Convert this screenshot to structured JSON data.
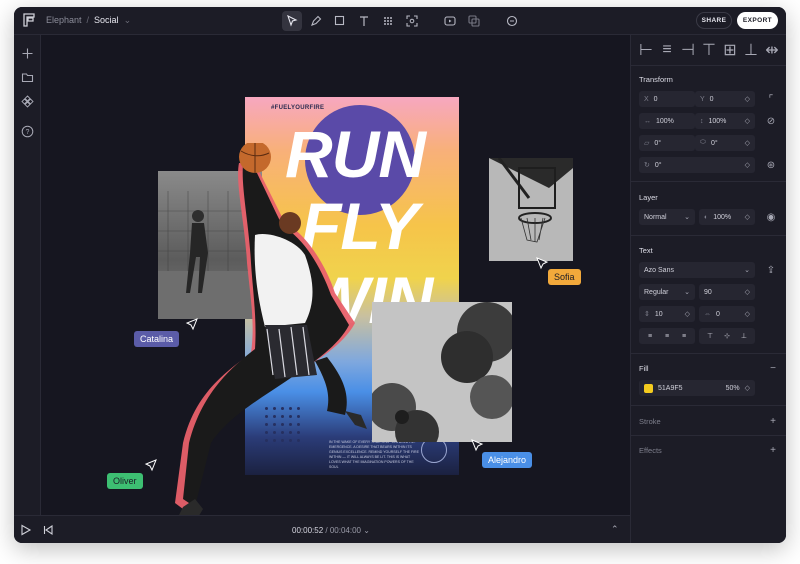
{
  "breadcrumb": {
    "project": "Elephant",
    "separator": "/",
    "page": "Social"
  },
  "toolbar": {
    "tools": [
      "select-tool",
      "pen-tool",
      "shape-tool",
      "text-tool",
      "grid-tool",
      "frame-tool",
      "media-tool",
      "boolean-tool",
      "comment-tool"
    ]
  },
  "actions": {
    "share": "SHARE",
    "export": "EXPORT"
  },
  "panel": {
    "transform": {
      "title": "Transform",
      "x_label": "X",
      "x": "0",
      "y_label": "Y",
      "y": "0",
      "width": "100%",
      "height": "100%",
      "skew_x": "0°",
      "skew_y": "0°",
      "rotation": "0°"
    },
    "layer": {
      "title": "Layer",
      "blend": "Normal",
      "opacity": "100%"
    },
    "text": {
      "title": "Text",
      "font": "Azo Sans",
      "weight": "Regular",
      "size": "90",
      "line_height": "10",
      "letter_spacing": "0"
    },
    "fill": {
      "title": "Fill",
      "hex": "51A9F5",
      "opacity": "50%",
      "swatch": "#f5cc1f"
    },
    "stroke": {
      "title": "Stroke"
    },
    "effects": {
      "title": "Effects"
    }
  },
  "poster": {
    "hashtag": "#FUELYOURFIRE",
    "line1": "RUN",
    "line2": "FLY",
    "line3": "WIN",
    "footer": "IN THE WAKE OF EVERY TRUE STEP IS A BOLD RE-EMERGENCE. A DESIRE THAT BEARS WITHIN ITS GENIUS EXCELLENCE. REMIND YOURSELF THE FIRE WITHIN — IT WILL ALWAYS BE LIT. THIS IS WHAT LOVES WHAT THE IMAGINATION POWERS OF THE SOUL"
  },
  "collaborators": [
    {
      "name": "Catalina",
      "color": "#5b5ca8"
    },
    {
      "name": "Sofia",
      "color": "#f2a93b"
    },
    {
      "name": "Alejandro",
      "color": "#4a8fe6"
    },
    {
      "name": "Oliver",
      "color": "#3dbf72"
    }
  ],
  "playback": {
    "current": "00:00:52",
    "separator": "/",
    "duration": "00:04:00"
  }
}
